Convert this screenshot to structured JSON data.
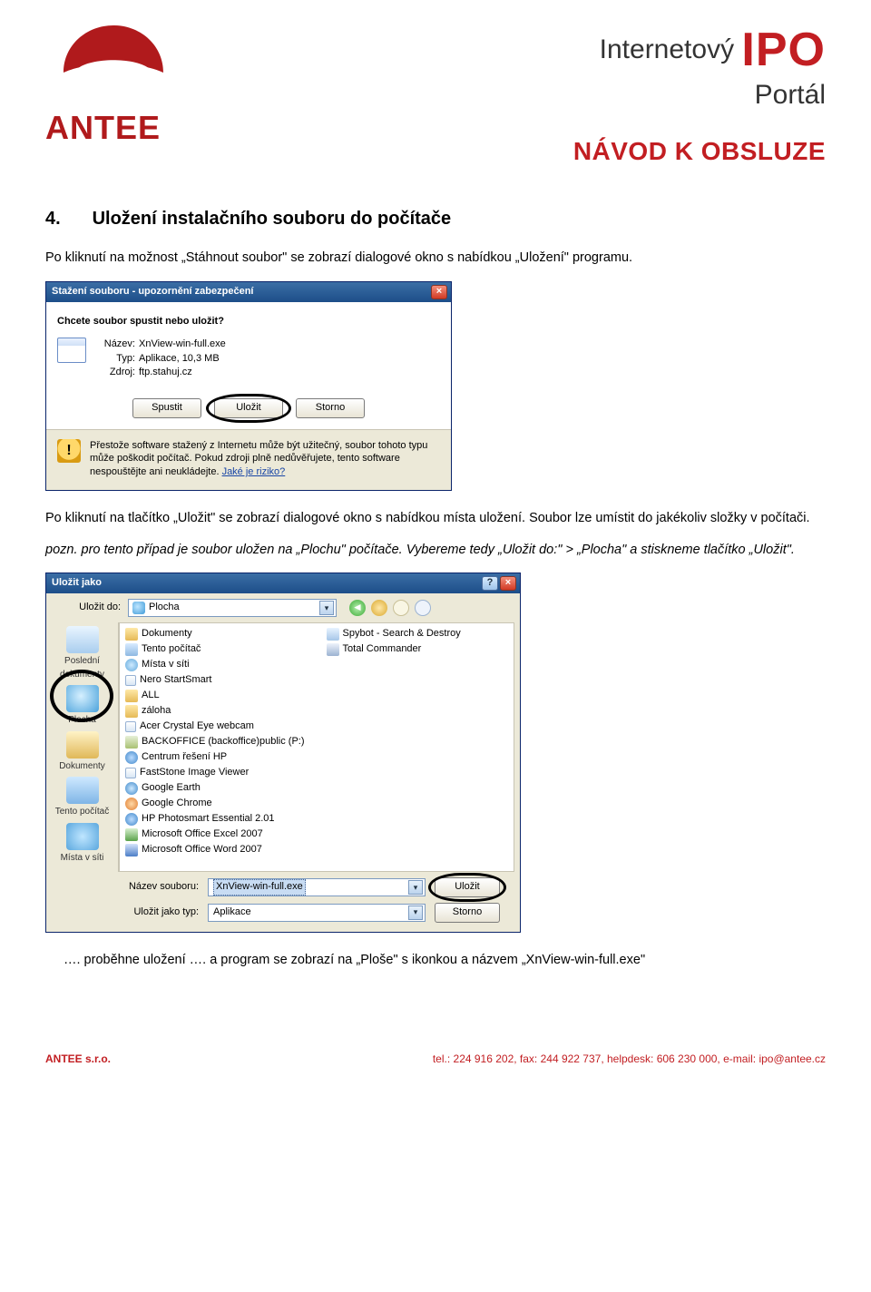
{
  "header": {
    "logo_text": "ANTEE",
    "ipo_line1_a": "Internetový",
    "ipo_line1_b": "IPO",
    "ipo_line2": "Portál",
    "navod": "NÁVOD K OBSLUZE"
  },
  "section": {
    "num": "4.",
    "title": "Uložení instalačního souboru do počítače"
  },
  "para1": "Po kliknutí na možnost „Stáhnout soubor\" se zobrazí dialogové okno s nabídkou „Uložení\" programu.",
  "dialog1": {
    "title": "Stažení souboru - upozornění zabezpečení",
    "prompt": "Chcete soubor spustit nebo uložit?",
    "kv": {
      "name_lbl": "Název:",
      "name_val": "XnView-win-full.exe",
      "type_lbl": "Typ:",
      "type_val": "Aplikace, 10,3 MB",
      "src_lbl": "Zdroj:",
      "src_val": "ftp.stahuj.cz"
    },
    "buttons": {
      "run": "Spustit",
      "save": "Uložit",
      "cancel": "Storno"
    },
    "warn_text_a": "Přestože software stažený z Internetu může být užitečný, soubor tohoto typu může poškodit počítač. Pokud zdroji plně nedůvěřujete, tento software nespouštějte ani neukládejte. ",
    "warn_link": "Jaké je riziko?"
  },
  "para2": "Po kliknutí na tlačítko „Uložit\" se zobrazí dialogové okno s nabídkou místa uložení. Soubor lze umístit do jakékoliv složky v počítači.",
  "para3": "pozn. pro tento případ je soubor uložen na „Plochu\" počítače. Vybereme tedy „Uložit do:\" > „Plocha\" a stiskneme tlačítko „Uložit\".",
  "dialog2": {
    "title": "Uložit jako",
    "saveto_lbl": "Uložit do:",
    "saveto_val": "Plocha",
    "places": {
      "recent": "Poslední dokumenty",
      "desktop": "Plocha",
      "docs": "Dokumenty",
      "pc": "Tento počítač",
      "net": "Místa v síti"
    },
    "files_col1": [
      {
        "icon": "ico-folder",
        "label": "Dokumenty"
      },
      {
        "icon": "ico-pc2",
        "label": "Tento počítač"
      },
      {
        "icon": "ico-net2",
        "label": "Místa v síti"
      },
      {
        "icon": "ico-app",
        "label": "Nero StartSmart"
      },
      {
        "icon": "ico-folder",
        "label": "ALL"
      },
      {
        "icon": "ico-folder",
        "label": "záloha"
      },
      {
        "icon": "ico-app",
        "label": "Acer Crystal Eye webcam"
      },
      {
        "icon": "ico-drive",
        "label": "BACKOFFICE (backoffice)public (P:)"
      },
      {
        "icon": "ico-hp",
        "label": "Centrum řešení HP"
      },
      {
        "icon": "ico-app",
        "label": "FastStone Image Viewer"
      },
      {
        "icon": "ico-ge",
        "label": "Google Earth"
      },
      {
        "icon": "ico-gc",
        "label": "Google Chrome"
      },
      {
        "icon": "ico-hp",
        "label": "HP Photosmart Essential 2.01"
      },
      {
        "icon": "ico-xl",
        "label": "Microsoft Office Excel 2007"
      },
      {
        "icon": "ico-wd",
        "label": "Microsoft Office Word 2007"
      }
    ],
    "files_col2": [
      {
        "icon": "ico-sb",
        "label": "Spybot - Search & Destroy"
      },
      {
        "icon": "ico-tc",
        "label": "Total Commander"
      }
    ],
    "name_lbl": "Název souboru:",
    "name_val": "XnView-win-full.exe",
    "type_lbl": "Uložit jako typ:",
    "type_val": "Aplikace",
    "save_btn": "Uložit",
    "cancel_btn": "Storno"
  },
  "para4": "…. proběhne uložení …. a program se zobrazí na „Ploše\" s ikonkou a názvem „XnView-win-full.exe\"",
  "footer": {
    "left": "ANTEE s.r.o.",
    "right": "tel.: 224 916 202, fax: 244 922 737, helpdesk: 606 230 000, e-mail: ipo@antee.cz"
  }
}
